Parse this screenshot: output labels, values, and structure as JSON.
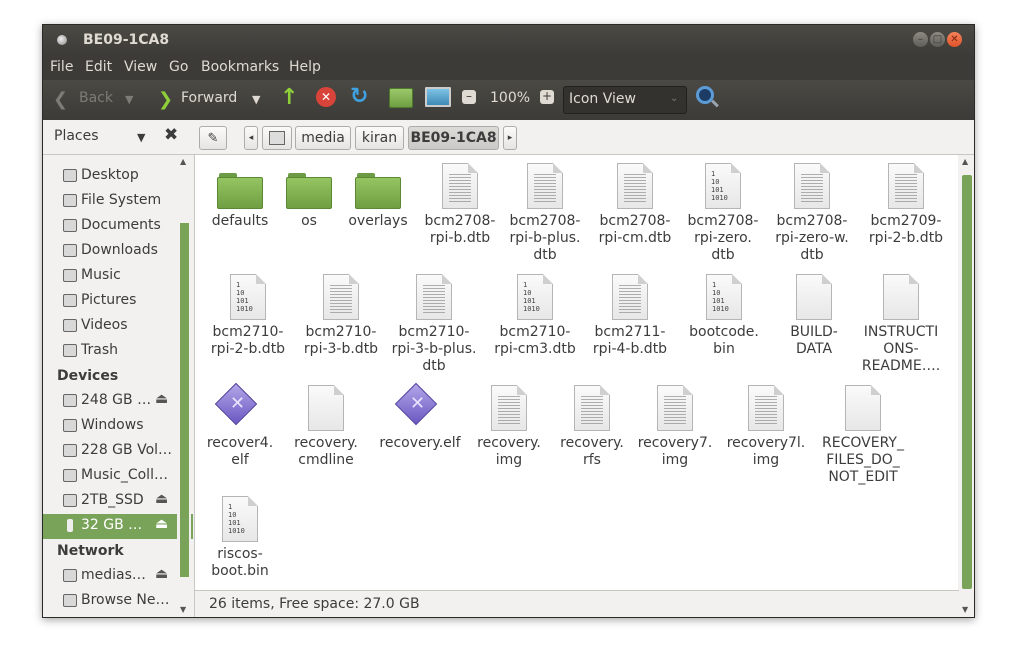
{
  "window": {
    "title": "BE09-1CA8"
  },
  "menubar": [
    "File",
    "Edit",
    "View",
    "Go",
    "Bookmarks",
    "Help"
  ],
  "toolbar": {
    "back": "Back",
    "forward": "Forward",
    "zoom": "100%",
    "view_mode": "Icon View"
  },
  "sidebar": {
    "header": "Places",
    "places": [
      "Desktop",
      "File System",
      "Documents",
      "Downloads",
      "Music",
      "Pictures",
      "Videos",
      "Trash"
    ],
    "devices_header": "Devices",
    "devices": [
      "248 GB …",
      "Windows",
      "228 GB Vol…",
      "Music_Coll…",
      "2TB_SSD",
      "32 GB …"
    ],
    "network_header": "Network",
    "network": [
      "medias…",
      "Browse Ne…"
    ]
  },
  "breadcrumb": [
    "media",
    "kiran",
    "BE09-1CA8"
  ],
  "files": [
    {
      "name": "defaults",
      "type": "folder"
    },
    {
      "name": "os",
      "type": "folder"
    },
    {
      "name": "overlays",
      "type": "folder"
    },
    {
      "name": "bcm2708-rpi-b.dtb",
      "type": "text"
    },
    {
      "name": "bcm2708-rpi-b-plus.dtb",
      "type": "text"
    },
    {
      "name": "bcm2708-rpi-cm.dtb",
      "type": "text"
    },
    {
      "name": "bcm2708-rpi-zero.dtb",
      "type": "binary"
    },
    {
      "name": "bcm2708-rpi-zero-w.dtb",
      "type": "text"
    },
    {
      "name": "bcm2709-rpi-2-b.dtb",
      "type": "text"
    },
    {
      "name": "bcm2710-rpi-2-b.dtb",
      "type": "binary"
    },
    {
      "name": "bcm2710-rpi-3-b.dtb",
      "type": "text"
    },
    {
      "name": "bcm2710-rpi-3-b-plus.dtb",
      "type": "text"
    },
    {
      "name": "bcm2710-rpi-cm3.dtb",
      "type": "binary"
    },
    {
      "name": "bcm2711-rpi-4-b.dtb",
      "type": "text"
    },
    {
      "name": "bootcode.bin",
      "type": "binary"
    },
    {
      "name": "BUILD-DATA",
      "type": "blank"
    },
    {
      "name": "INSTRUCTIONS-README….",
      "type": "blank"
    },
    {
      "name": "recover4.elf",
      "type": "elf"
    },
    {
      "name": "recovery.cmdline",
      "type": "blank"
    },
    {
      "name": "recovery.elf",
      "type": "elf"
    },
    {
      "name": "recovery.img",
      "type": "text"
    },
    {
      "name": "recovery.rfs",
      "type": "text"
    },
    {
      "name": "recovery7.img",
      "type": "text"
    },
    {
      "name": "recovery7l.img",
      "type": "text"
    },
    {
      "name": "RECOVERY_FILES_DO_NOT_EDIT",
      "type": "blank"
    },
    {
      "name": "riscos-boot.bin",
      "type": "binary"
    }
  ],
  "file_labels": [
    [
      "defaults"
    ],
    [
      "os"
    ],
    [
      "overlays"
    ],
    [
      "bcm2708-",
      "rpi-b.dtb"
    ],
    [
      "bcm2708-",
      "rpi-b-plus.",
      "dtb"
    ],
    [
      "bcm2708-",
      "rpi-cm.dtb"
    ],
    [
      "bcm2708-",
      "rpi-zero.",
      "dtb"
    ],
    [
      "bcm2708-",
      "rpi-zero-w.",
      "dtb"
    ],
    [
      "bcm2709-",
      "rpi-2-b.dtb"
    ],
    [
      "bcm2710-",
      "rpi-2-b.dtb"
    ],
    [
      "bcm2710-",
      "rpi-3-b.dtb"
    ],
    [
      "bcm2710-",
      "rpi-3-b-plus.",
      "dtb"
    ],
    [
      "bcm2710-",
      "rpi-cm3.dtb"
    ],
    [
      "bcm2711-",
      "rpi-4-b.dtb"
    ],
    [
      "bootcode.",
      "bin"
    ],
    [
      "BUILD-",
      "DATA"
    ],
    [
      "INSTRUCTI",
      "ONS-",
      "README…."
    ],
    [
      "recover4.",
      "elf"
    ],
    [
      "recovery.",
      "cmdline"
    ],
    [
      "recovery.elf"
    ],
    [
      "recovery.",
      "img"
    ],
    [
      "recovery.",
      "rfs"
    ],
    [
      "recovery7.",
      "img"
    ],
    [
      "recovery7l.",
      "img"
    ],
    [
      "RECOVERY_",
      "FILES_DO_",
      "NOT_EDIT"
    ],
    [
      "riscos-",
      "boot.bin"
    ]
  ],
  "binary_glyph": "1\n10\n101\n1010",
  "status": "26 items, Free space: 27.0 GB",
  "colors": {
    "accent": "#7aa35a",
    "toolbar": "#3c3b37",
    "close": "#e0532a"
  }
}
